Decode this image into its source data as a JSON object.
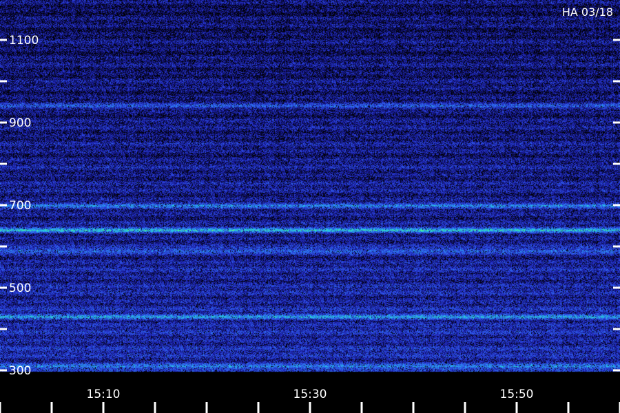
{
  "label": "HA 03/18",
  "chart_data": {
    "type": "heatmap",
    "title": "",
    "xlabel": "",
    "ylabel": "",
    "y_ticks": [
      {
        "value": 1100,
        "label": "1100"
      },
      {
        "value": 900,
        "label": "900"
      },
      {
        "value": 700,
        "label": "700"
      },
      {
        "value": 500,
        "label": "500"
      },
      {
        "value": 300,
        "label": "300"
      }
    ],
    "y_minor_ticks": [
      1000,
      800,
      600,
      400
    ],
    "ylim": [
      300,
      1100
    ],
    "x_ticks": [
      {
        "value": "15:10",
        "label": "15:10"
      },
      {
        "value": "15:30",
        "label": "15:30"
      },
      {
        "value": "15:50",
        "label": "15:50"
      }
    ],
    "xlim": [
      "15:00",
      "16:00"
    ],
    "colormap": [
      "#000000",
      "#14148c",
      "#2a3cd8",
      "#2f6ff0",
      "#25c8e8",
      "#3cf28a",
      "#f0f050"
    ],
    "bright_bands": [
      {
        "value": 940,
        "strength": 0.5
      },
      {
        "value": 700,
        "strength": 0.6
      },
      {
        "value": 640,
        "strength": 0.9
      },
      {
        "value": 590,
        "strength": 0.5
      },
      {
        "value": 430,
        "strength": 0.75
      },
      {
        "value": 310,
        "strength": 0.6
      }
    ]
  }
}
